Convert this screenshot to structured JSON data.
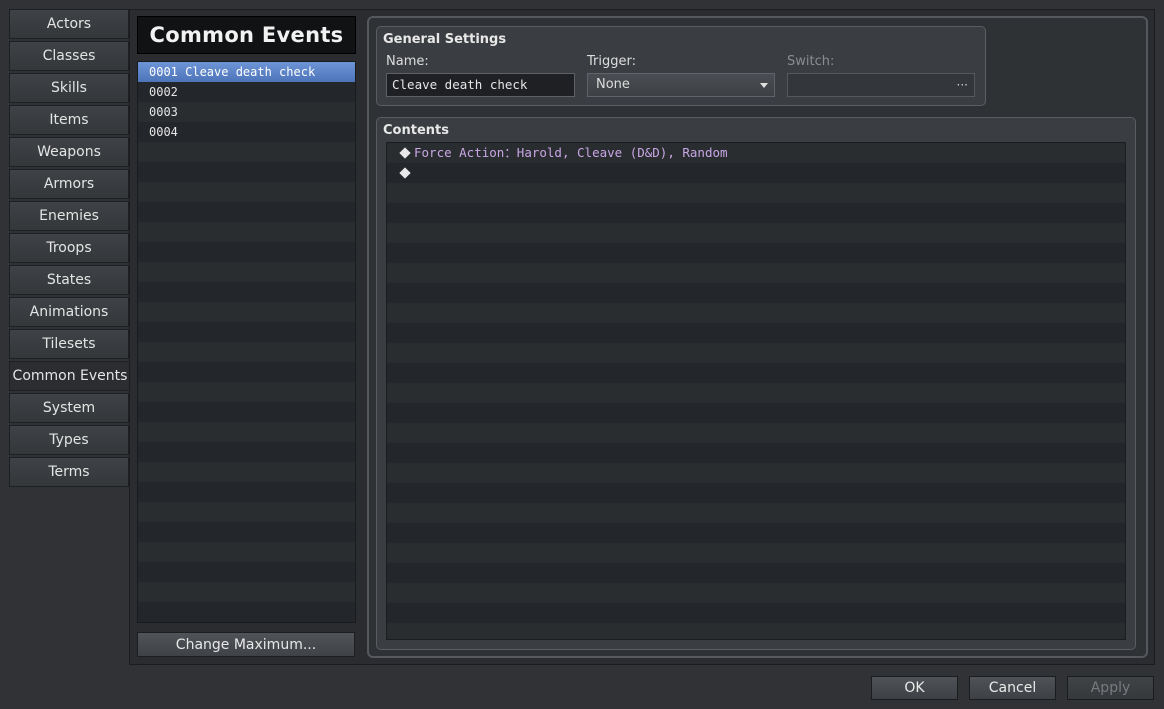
{
  "tabs": [
    {
      "label": "Actors"
    },
    {
      "label": "Classes"
    },
    {
      "label": "Skills"
    },
    {
      "label": "Items"
    },
    {
      "label": "Weapons"
    },
    {
      "label": "Armors"
    },
    {
      "label": "Enemies"
    },
    {
      "label": "Troops"
    },
    {
      "label": "States"
    },
    {
      "label": "Animations"
    },
    {
      "label": "Tilesets"
    },
    {
      "label": "Common Events"
    },
    {
      "label": "System"
    },
    {
      "label": "Types"
    },
    {
      "label": "Terms"
    }
  ],
  "active_tab": "Common Events",
  "list": {
    "title": "Common Events",
    "items": [
      {
        "label": "0001 Cleave death check"
      },
      {
        "label": "0002"
      },
      {
        "label": "0003"
      },
      {
        "label": "0004"
      }
    ],
    "selected_index": 0,
    "change_max_label": "Change Maximum..."
  },
  "general": {
    "title": "General Settings",
    "name_label": "Name:",
    "name_value": "Cleave death check",
    "trigger_label": "Trigger:",
    "trigger_value": "None",
    "switch_label": "Switch:",
    "switch_value": "",
    "switch_button": "···"
  },
  "contents": {
    "title": "Contents",
    "commands": [
      {
        "text": "Force Action：Harold, Cleave (D&D), Random"
      },
      {
        "text": ""
      }
    ]
  },
  "buttons": {
    "ok": "OK",
    "cancel": "Cancel",
    "apply": "Apply"
  },
  "colors": {
    "selection": "#5a82c6",
    "command_text": "#c9a6e6",
    "background": "#303235"
  }
}
